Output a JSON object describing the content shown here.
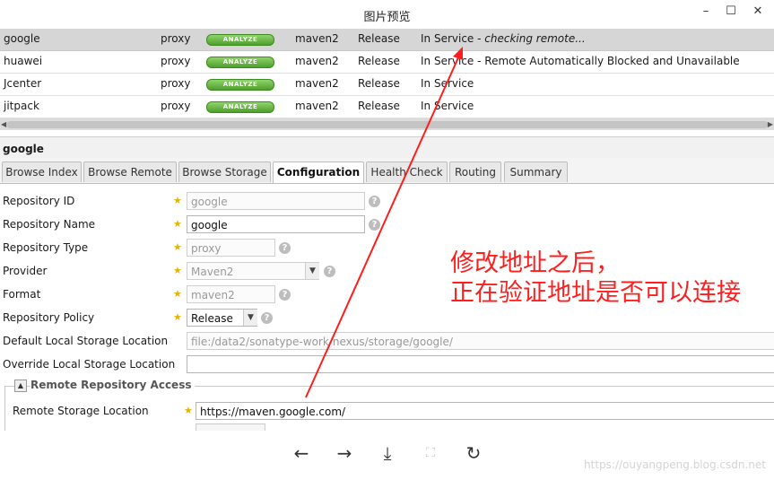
{
  "window": {
    "title": "图片预览",
    "minimize": "–",
    "maximize": "☐",
    "close": "✕"
  },
  "repos": [
    {
      "name": "google",
      "type": "proxy",
      "health": "ANALYZE",
      "format": "maven2",
      "policy": "Release",
      "status_plain": "In Service - ",
      "status_italic": "checking remote...",
      "selected": true
    },
    {
      "name": "huawei",
      "type": "proxy",
      "health": "ANALYZE",
      "format": "maven2",
      "policy": "Release",
      "status_plain": "In Service - Remote Automatically Blocked and Unavailable",
      "status_italic": "",
      "selected": false
    },
    {
      "name": "Jcenter",
      "type": "proxy",
      "health": "ANALYZE",
      "format": "maven2",
      "policy": "Release",
      "status_plain": "In Service",
      "status_italic": "",
      "selected": false
    },
    {
      "name": "jitpack",
      "type": "proxy",
      "health": "ANALYZE",
      "format": "maven2",
      "policy": "Release",
      "status_plain": "In Service",
      "status_italic": "",
      "selected": false
    }
  ],
  "detail": {
    "title": "google",
    "tabs": [
      "Browse Index",
      "Browse Remote",
      "Browse Storage",
      "Configuration",
      "Health Check",
      "Routing",
      "Summary"
    ],
    "active_tab": "Configuration"
  },
  "form": {
    "repo_id_label": "Repository ID",
    "repo_id_value": "google",
    "repo_name_label": "Repository Name",
    "repo_name_value": "google",
    "repo_type_label": "Repository Type",
    "repo_type_value": "proxy",
    "provider_label": "Provider",
    "provider_value": "Maven2",
    "format_label": "Format",
    "format_value": "maven2",
    "policy_label": "Repository Policy",
    "policy_value": "Release",
    "default_storage_label": "Default Local Storage Location",
    "default_storage_value": "file:/data2/sonatype-work/nexus/storage/google/",
    "override_storage_label": "Override Local Storage Location",
    "override_storage_value": "",
    "remote_section_label": "Remote Repository Access",
    "remote_location_label": "Remote Storage Location",
    "remote_location_value": "https://maven.google.com/"
  },
  "annotation": {
    "line1": "修改地址之后，",
    "line2": "正在验证地址是否可以连接",
    "color": "#ff1e1e"
  },
  "toolbar": {
    "prev": "←",
    "next": "→",
    "download": "⤓",
    "fit": "⛶",
    "rotate": "↻"
  },
  "watermark": "https://ouyangpeng.blog.csdn.net"
}
